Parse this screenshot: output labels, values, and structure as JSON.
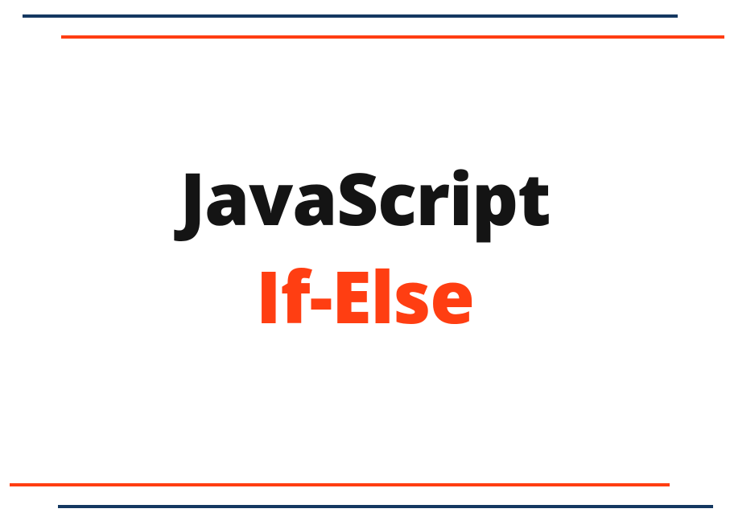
{
  "title": {
    "line1": "JavaScript",
    "line2": "If-Else"
  },
  "colors": {
    "blue": "#143861",
    "orange": "#ff3e12",
    "black": "#141414"
  }
}
